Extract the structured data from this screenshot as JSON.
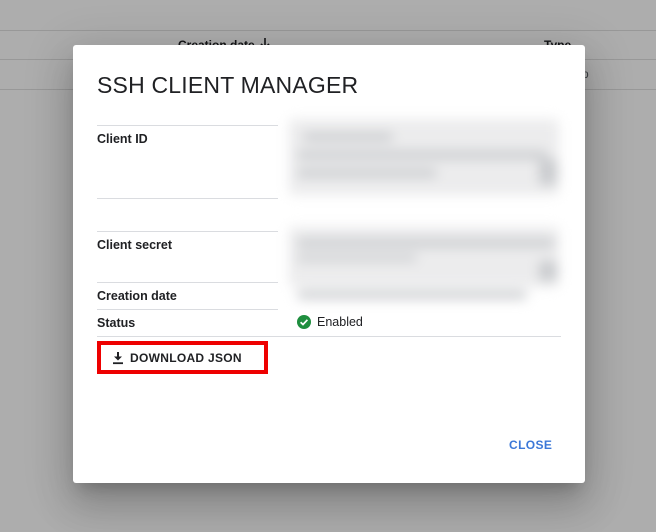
{
  "background": {
    "table_header": {
      "creation_date_label": "Creation date",
      "type_label": "Type"
    },
    "row_partial_text": "p"
  },
  "dialog": {
    "title": "SSH CLIENT MANAGER",
    "fields": {
      "client_id_label": "Client ID",
      "client_secret_label": "Client secret",
      "creation_date_label": "Creation date",
      "status_label": "Status"
    },
    "status_value": "Enabled",
    "status_color": "#1e8e3e",
    "download_button_label": "DOWNLOAD JSON",
    "download_highlight_color": "#ee0000",
    "close_button_label": "CLOSE",
    "accent_color": "#3c78d8"
  },
  "icons": {
    "sort": "sort-arrow-down-icon",
    "download": "download-icon",
    "status": "check-circle-icon"
  }
}
